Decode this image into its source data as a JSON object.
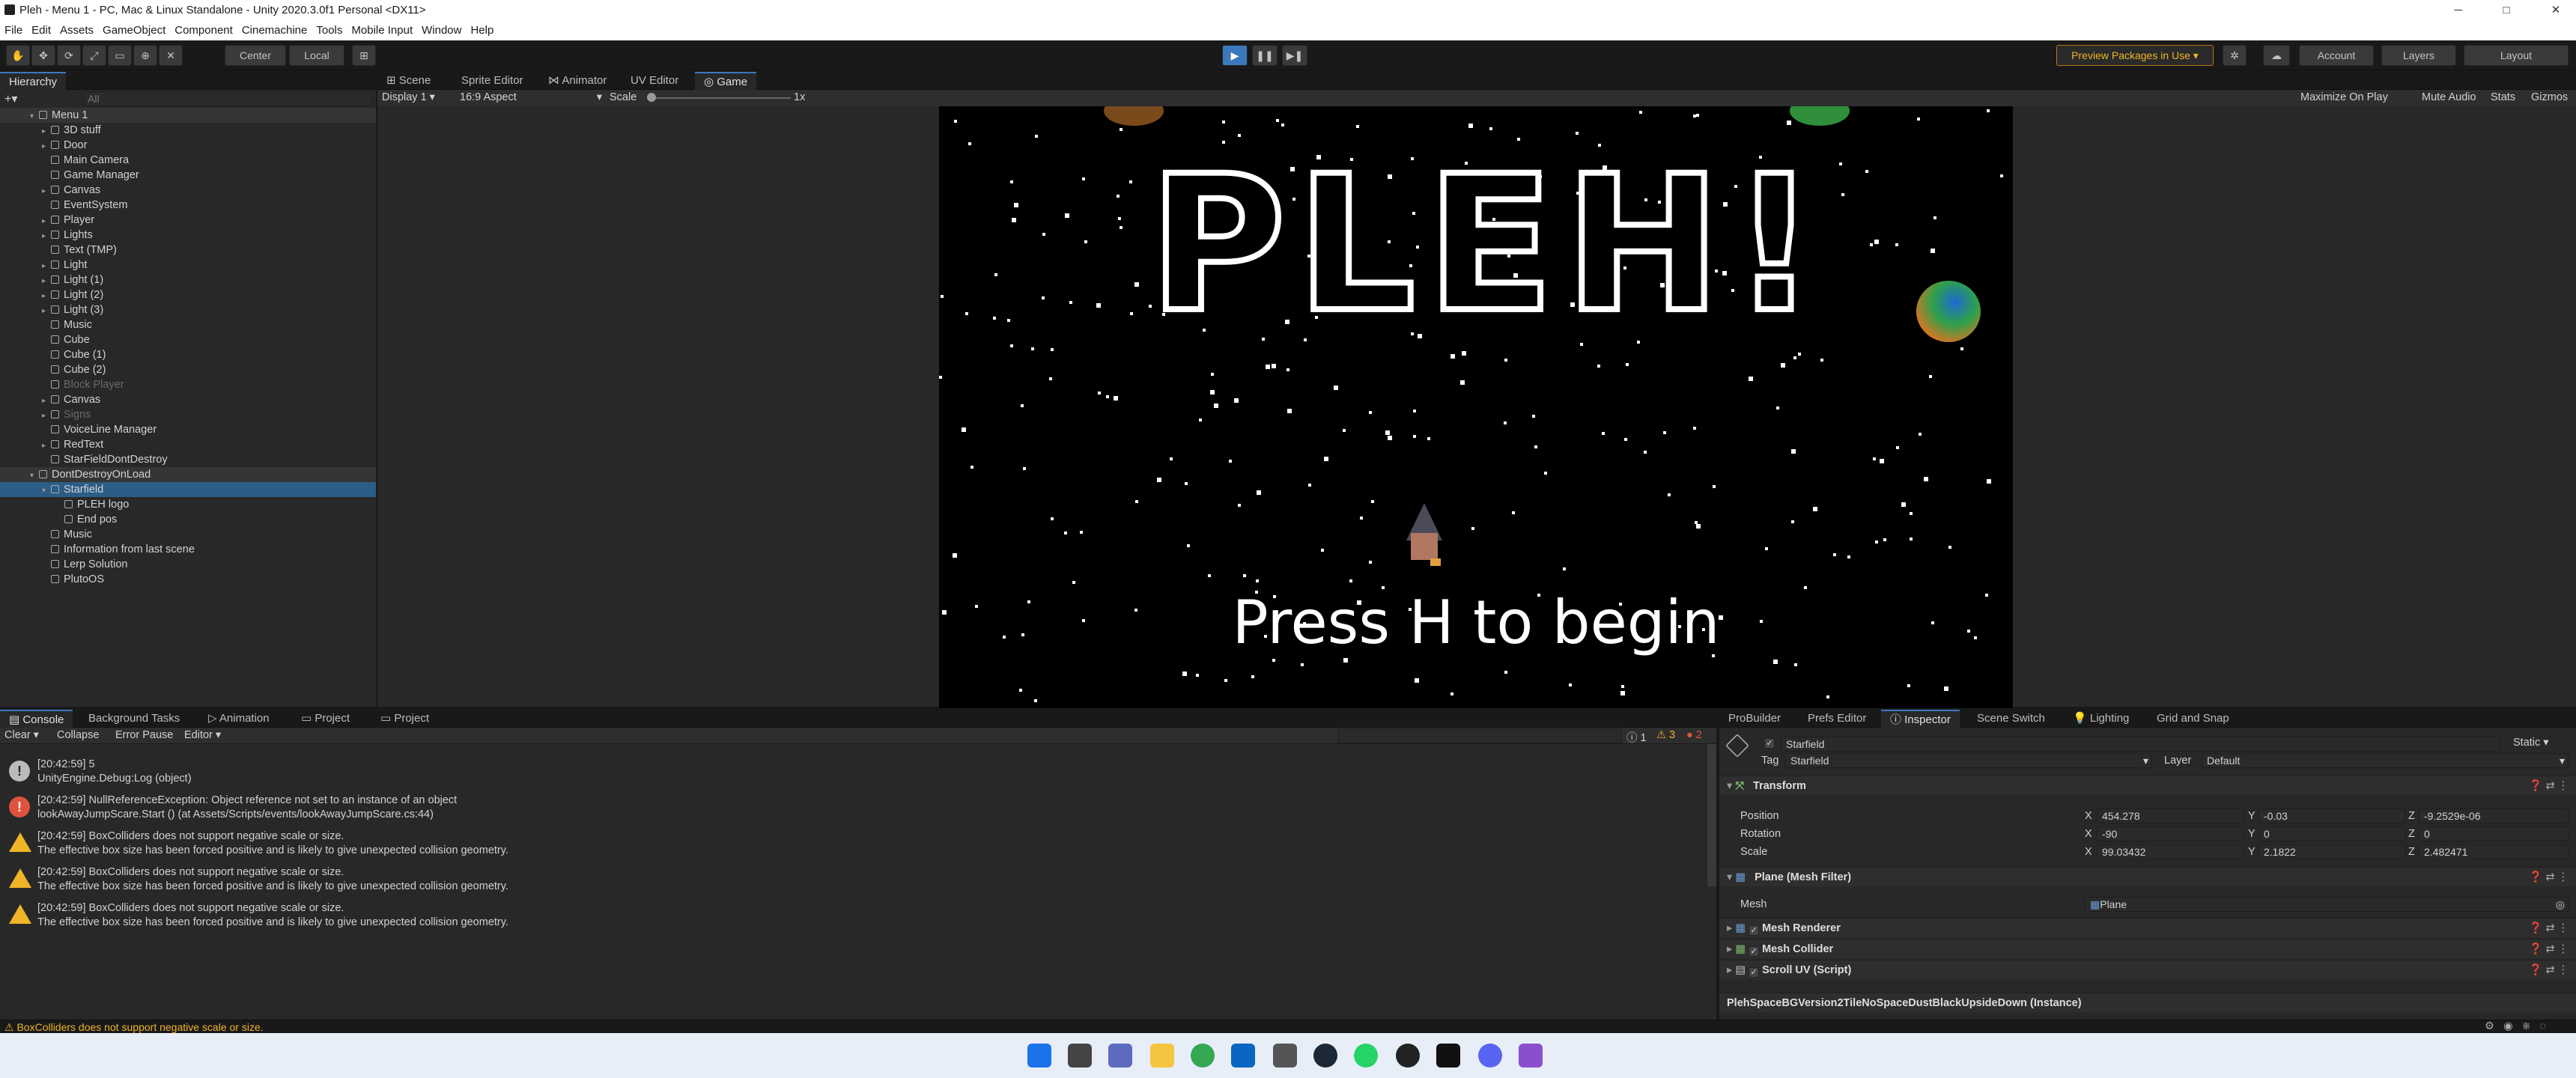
{
  "window": {
    "title": "Pleh - Menu 1 - PC, Mac & Linux Standalone - Unity 2020.3.0f1 Personal <DX11>",
    "controls": [
      "─",
      "□",
      "✕"
    ]
  },
  "menu": [
    "File",
    "Edit",
    "Assets",
    "GameObject",
    "Component",
    "Cinemachine",
    "Tools",
    "Mobile Input",
    "Window",
    "Help"
  ],
  "toolbar": {
    "pivot": "Center",
    "space": "Local",
    "preview_packages": "Preview Packages in Use ▾",
    "account": "Account",
    "layers": "Layers",
    "layout": "Layout"
  },
  "hierarchy": {
    "tab": "Hierarchy",
    "search_placeholder": "All",
    "items": [
      {
        "label": "Menu 1",
        "kind": "scene",
        "depth": 0
      },
      {
        "label": "3D stuff",
        "depth": 1,
        "arrow": true
      },
      {
        "label": "Door",
        "depth": 1,
        "arrow": true
      },
      {
        "label": "Main Camera",
        "depth": 1
      },
      {
        "label": "Game Manager",
        "depth": 1
      },
      {
        "label": "Canvas",
        "depth": 1,
        "arrow": true
      },
      {
        "label": "EventSystem",
        "depth": 1
      },
      {
        "label": "Player",
        "depth": 1,
        "arrow": true
      },
      {
        "label": "Lights",
        "depth": 1,
        "arrow": true
      },
      {
        "label": "Text (TMP)",
        "depth": 1
      },
      {
        "label": "Light",
        "depth": 1,
        "arrow": true
      },
      {
        "label": "Light (1)",
        "depth": 1,
        "arrow": true
      },
      {
        "label": "Light (2)",
        "depth": 1,
        "arrow": true
      },
      {
        "label": "Light (3)",
        "depth": 1,
        "arrow": true
      },
      {
        "label": "Music",
        "depth": 1
      },
      {
        "label": "Cube",
        "depth": 1
      },
      {
        "label": "Cube (1)",
        "depth": 1
      },
      {
        "label": "Cube (2)",
        "depth": 1
      },
      {
        "label": "Block Player",
        "depth": 1,
        "dim": true
      },
      {
        "label": "Canvas",
        "depth": 1,
        "arrow": true
      },
      {
        "label": "Signs",
        "depth": 1,
        "arrow": true,
        "dim": true
      },
      {
        "label": "VoiceLine Manager",
        "depth": 1
      },
      {
        "label": "RedText",
        "depth": 1,
        "arrow": true
      },
      {
        "label": "StarFieldDontDestroy",
        "depth": 1
      },
      {
        "label": "DontDestroyOnLoad",
        "kind": "scene",
        "depth": 0
      },
      {
        "label": "Starfield",
        "depth": 1,
        "arrow": true,
        "selected": true
      },
      {
        "label": "PLEH logo",
        "depth": 2
      },
      {
        "label": "End pos",
        "depth": 2
      },
      {
        "label": "Music",
        "depth": 1
      },
      {
        "label": "Information from last scene",
        "depth": 1
      },
      {
        "label": "Lerp Solution",
        "depth": 1
      },
      {
        "label": "PlutoOS",
        "depth": 1
      }
    ]
  },
  "view_tabs": [
    "Scene",
    "Sprite Editor",
    "Animator",
    "UV Editor",
    "Game"
  ],
  "game_bar": {
    "display": "Display 1",
    "aspect": "16:9 Aspect",
    "scale_label": "Scale",
    "scale_value": "1x",
    "maximize": "Maximize On Play",
    "mute": "Mute Audio",
    "stats": "Stats",
    "gizmos": "Gizmos"
  },
  "game": {
    "logo": "PLEH!",
    "prompt": "Press H to begin",
    "colors": {
      "planet": "#2f8f3a",
      "planet2": "#e8711f",
      "sky": "#000000"
    }
  },
  "bottom_tabs": [
    "Console",
    "Background Tasks",
    "Animation",
    "Project",
    "Project"
  ],
  "console_bar": {
    "clear": "Clear",
    "collapse": "Collapse",
    "error_pause": "Error Pause",
    "editor": "Editor",
    "count_info": "1",
    "count_warn": "3",
    "count_err": "2"
  },
  "console": [
    {
      "type": "info",
      "line1": "[20:42:59] 5",
      "line2": "UnityEngine.Debug:Log (object)"
    },
    {
      "type": "error",
      "line1": "[20:42:59] NullReferenceException: Object reference not set to an instance of an object",
      "line2": "lookAwayJumpScare.Start () (at Assets/Scripts/events/lookAwayJumpScare.cs:44)"
    },
    {
      "type": "warn",
      "line1": "[20:42:59] BoxColliders does not support negative scale or size.",
      "line2": "The effective box size has been forced positive and is likely to give unexpected collision geometry."
    },
    {
      "type": "warn",
      "line1": "[20:42:59] BoxColliders does not support negative scale or size.",
      "line2": "The effective box size has been forced positive and is likely to give unexpected collision geometry."
    },
    {
      "type": "warn",
      "line1": "[20:42:59] BoxColliders does not support negative scale or size.",
      "line2": "The effective box size has been forced positive and is likely to give unexpected collision geometry."
    }
  ],
  "status": "BoxColliders does not support negative scale or size.",
  "inspector_tabs": [
    "ProBuilder",
    "Prefs Editor",
    "Inspector",
    "Scene Switch",
    "Lighting",
    "Grid and Snap"
  ],
  "inspector": {
    "name": "Starfield",
    "static": "Static",
    "tag_label": "Tag",
    "tag": "Starfield",
    "layer_label": "Layer",
    "layer": "Default",
    "transform": "Transform",
    "position_label": "Position",
    "rotation_label": "Rotation",
    "scale_label": "Scale",
    "position": [
      "454.278",
      "-0.03",
      "-9.2529e-06"
    ],
    "rotation": [
      "-90",
      "0",
      "0"
    ],
    "scale": [
      "99.03432",
      "2.1822",
      "2.482471"
    ],
    "mesh_filter": "Plane (Mesh Filter)",
    "mesh_label": "Mesh",
    "mesh": "Plane",
    "mesh_renderer": "Mesh Renderer",
    "mesh_collider": "Mesh Collider",
    "scroll_uv": "Scroll UV (Script)",
    "material": "PlehSpaceBGVersion2TileNoSpaceDustBlackUpsideDown (Instance)"
  }
}
